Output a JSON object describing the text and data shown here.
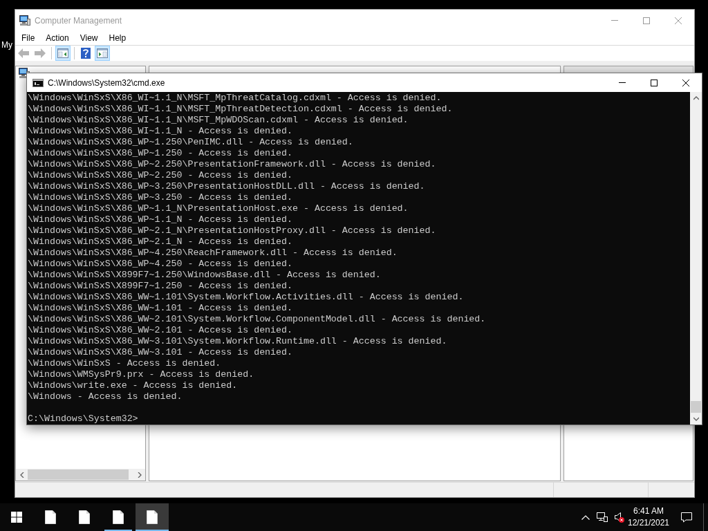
{
  "desktop": {
    "icon_label": "My"
  },
  "mmc_window": {
    "title": "Computer Management",
    "active": false,
    "menu": [
      "File",
      "Action",
      "View",
      "Help"
    ],
    "toolbar": [
      [
        {
          "kind": "back",
          "disabled": true,
          "on": false
        },
        {
          "kind": "forward",
          "disabled": true,
          "on": false
        }
      ],
      [
        {
          "kind": "console-tree",
          "disabled": false,
          "on": true
        }
      ],
      [
        {
          "kind": "help",
          "disabled": false,
          "on": false
        },
        {
          "kind": "action-pane",
          "disabled": false,
          "on": true
        }
      ]
    ]
  },
  "cmd_window": {
    "title": "C:\\Windows\\System32\\cmd.exe",
    "active": true,
    "lines": [
      "\\Windows\\WinSxS\\X86_WI~1.1_N\\MSFT_MpThreatCatalog.cdxml - Access is denied.",
      "\\Windows\\WinSxS\\X86_WI~1.1_N\\MSFT_MpThreatDetection.cdxml - Access is denied.",
      "\\Windows\\WinSxS\\X86_WI~1.1_N\\MSFT_MpWDOScan.cdxml - Access is denied.",
      "\\Windows\\WinSxS\\X86_WI~1.1_N - Access is denied.",
      "\\Windows\\WinSxS\\X86_WP~1.250\\PenIMC.dll - Access is denied.",
      "\\Windows\\WinSxS\\X86_WP~1.250 - Access is denied.",
      "\\Windows\\WinSxS\\X86_WP~2.250\\PresentationFramework.dll - Access is denied.",
      "\\Windows\\WinSxS\\X86_WP~2.250 - Access is denied.",
      "\\Windows\\WinSxS\\X86_WP~3.250\\PresentationHostDLL.dll - Access is denied.",
      "\\Windows\\WinSxS\\X86_WP~3.250 - Access is denied.",
      "\\Windows\\WinSxS\\X86_WP~1.1_N\\PresentationHost.exe - Access is denied.",
      "\\Windows\\WinSxS\\X86_WP~1.1_N - Access is denied.",
      "\\Windows\\WinSxS\\X86_WP~2.1_N\\PresentationHostProxy.dll - Access is denied.",
      "\\Windows\\WinSxS\\X86_WP~2.1_N - Access is denied.",
      "\\Windows\\WinSxS\\X86_WP~4.250\\ReachFramework.dll - Access is denied.",
      "\\Windows\\WinSxS\\X86_WP~4.250 - Access is denied.",
      "\\Windows\\WinSxS\\X899F7~1.250\\WindowsBase.dll - Access is denied.",
      "\\Windows\\WinSxS\\X899F7~1.250 - Access is denied.",
      "\\Windows\\WinSxS\\X86_WW~1.101\\System.Workflow.Activities.dll - Access is denied.",
      "\\Windows\\WinSxS\\X86_WW~1.101 - Access is denied.",
      "\\Windows\\WinSxS\\X86_WW~2.101\\System.Workflow.ComponentModel.dll - Access is denied.",
      "\\Windows\\WinSxS\\X86_WW~2.101 - Access is denied.",
      "\\Windows\\WinSxS\\X86_WW~3.101\\System.Workflow.Runtime.dll - Access is denied.",
      "\\Windows\\WinSxS\\X86_WW~3.101 - Access is denied.",
      "\\Windows\\WinSxS - Access is denied.",
      "\\Windows\\WMSysPr9.prx - Access is denied.",
      "\\Windows\\write.exe - Access is denied.",
      "\\Windows - Access is denied."
    ],
    "prompt": "C:\\Windows\\System32>"
  },
  "taskbar": {
    "apps": [
      {
        "running": false,
        "selected": false
      },
      {
        "running": false,
        "selected": false
      },
      {
        "running": true,
        "selected": false
      },
      {
        "running": true,
        "selected": true
      }
    ],
    "tray": {
      "sound_error": true,
      "time": "6:41 AM",
      "date": "12/21/2021"
    }
  }
}
